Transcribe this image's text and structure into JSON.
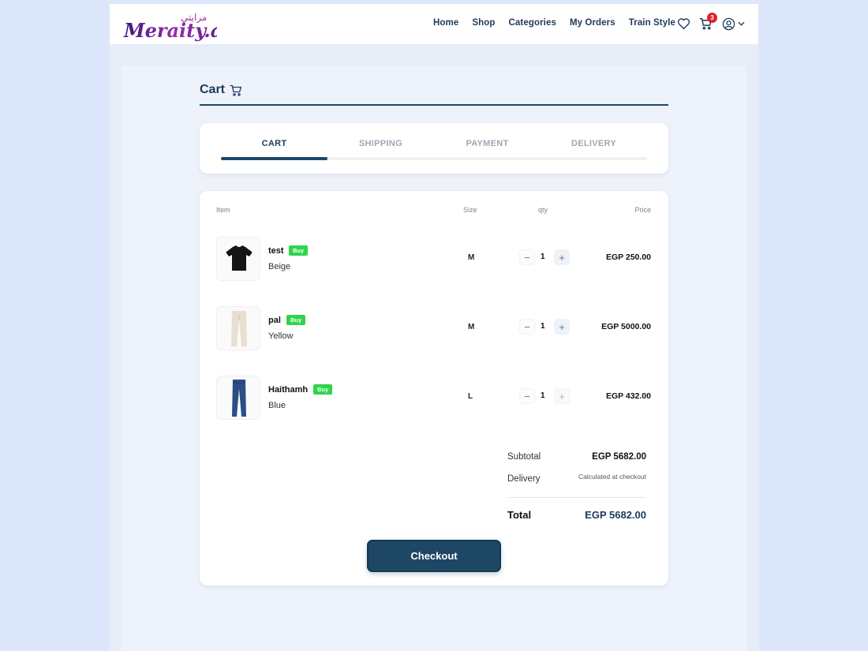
{
  "brand": {
    "logo_text": "Meraity.ai",
    "logo_arabic": "مرايتي"
  },
  "nav": [
    {
      "label": "Home"
    },
    {
      "label": "Shop"
    },
    {
      "label": "Categories"
    },
    {
      "label": "My Orders"
    },
    {
      "label": "Train Style"
    }
  ],
  "header_icons": {
    "wishlist": "heart-icon",
    "cart": "cart-icon",
    "cart_count": "3",
    "account": "user-circle-icon",
    "account_menu": "chevron-down-icon"
  },
  "page": {
    "title": "Cart",
    "title_icon": "cart-icon"
  },
  "steps": [
    {
      "label": "CART",
      "active": true
    },
    {
      "label": "SHIPPING",
      "active": false
    },
    {
      "label": "PAYMENT",
      "active": false
    },
    {
      "label": "DELIVERY",
      "active": false
    }
  ],
  "progress_fraction": 0.25,
  "table": {
    "headers": {
      "item": "Item",
      "size": "Size",
      "qty": "qty",
      "price": "Price"
    }
  },
  "items": [
    {
      "name": "test",
      "badge": "Buy",
      "color": "Beige",
      "size": "M",
      "qty": "1",
      "price": "EGP 250.00",
      "thumb": "black-top"
    },
    {
      "name": "pal",
      "badge": "Buy",
      "color": "Yellow",
      "size": "M",
      "qty": "1",
      "price": "EGP 5000.00",
      "thumb": "beige-pants"
    },
    {
      "name": "Haithamh",
      "badge": "Buy",
      "color": "Blue",
      "size": "L",
      "qty": "1",
      "price": "EGP 432.00",
      "thumb": "blue-jeans"
    }
  ],
  "summary": {
    "subtotal_label": "Subtotal",
    "subtotal": "EGP 5682.00",
    "delivery_label": "Delivery",
    "delivery_note": "Calculated at checkout",
    "total_label": "Total",
    "total": "EGP 5682.00"
  },
  "checkout_label": "Checkout",
  "colors": {
    "primary": "#1e4766",
    "buy_badge": "#2fd44c",
    "cart_badge": "#e0202c",
    "logo_purple": "#7a2bb0"
  }
}
